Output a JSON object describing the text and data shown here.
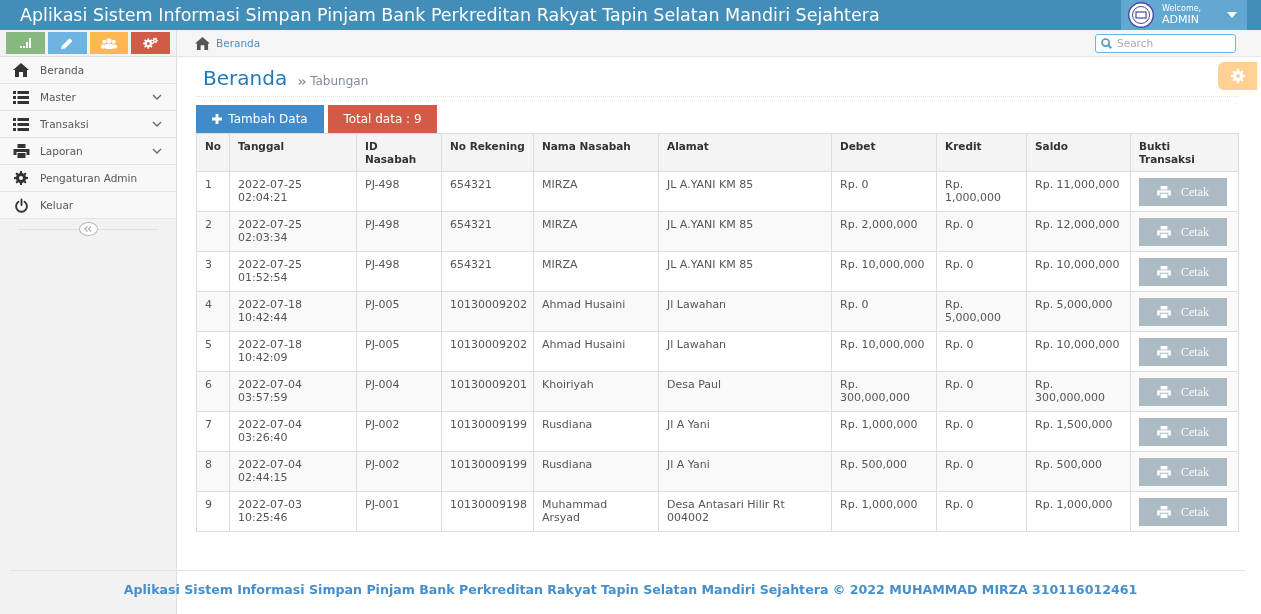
{
  "navbar": {
    "title": "Aplikasi Sistem Informasi Simpan Pinjam Bank Perkreditan Rakyat Tapin Selatan Mandiri Sejahtera",
    "user": {
      "greeting": "Welcome,",
      "name": "ADMIN"
    }
  },
  "sidebar": {
    "shortcuts": [
      {
        "kind": "chart",
        "color": "#87b87f"
      },
      {
        "kind": "pencil",
        "color": "#6fb3e0"
      },
      {
        "kind": "users",
        "color": "#ffb752"
      },
      {
        "kind": "cogs",
        "color": "#d15b47"
      }
    ],
    "menu": [
      {
        "label": "Beranda",
        "kind": "home",
        "has_submenu": false
      },
      {
        "label": "Master",
        "kind": "list",
        "has_submenu": true
      },
      {
        "label": "Transaksi",
        "kind": "list",
        "has_submenu": true
      },
      {
        "label": "Laporan",
        "kind": "print",
        "has_submenu": true
      },
      {
        "label": "Pengaturan Admin",
        "kind": "gear",
        "has_submenu": false
      },
      {
        "label": "Keluar",
        "kind": "power",
        "has_submenu": false
      }
    ]
  },
  "breadcrumb": [
    {
      "label": "Beranda"
    }
  ],
  "search": {
    "placeholder": "Search"
  },
  "page_header": {
    "title": "Beranda",
    "subtitle": "Tabungan"
  },
  "toolbar": {
    "add_button": "Tambah Data",
    "total_badge": "Total data : 9"
  },
  "table": {
    "columns": [
      "No",
      "Tanggal",
      "ID Nasabah",
      "No Rekening",
      "Nama Nasabah",
      "Alamat",
      "Debet",
      "Kredit",
      "Saldo",
      "Bukti Transaksi"
    ],
    "rows": [
      {
        "cells": [
          "1",
          "2022-07-25 02:04:21",
          "PJ-498",
          "654321",
          "MIRZA",
          "JL A.YANI KM 85",
          "Rp. 0",
          "Rp. 1,000,000",
          "Rp. 11,000,000"
        ],
        "action": "Cetak"
      },
      {
        "cells": [
          "2",
          "2022-07-25 02:03:34",
          "PJ-498",
          "654321",
          "MIRZA",
          "JL A.YANI KM 85",
          "Rp. 2,000,000",
          "Rp. 0",
          "Rp. 12,000,000"
        ],
        "action": "Cetak"
      },
      {
        "cells": [
          "3",
          "2022-07-25 01:52:54",
          "PJ-498",
          "654321",
          "MIRZA",
          "JL A.YANI KM 85",
          "Rp. 10,000,000",
          "Rp. 0",
          "Rp. 10,000,000"
        ],
        "action": "Cetak"
      },
      {
        "cells": [
          "4",
          "2022-07-18 10:42:44",
          "PJ-005",
          "10130009202",
          "Ahmad Husaini",
          "Jl Lawahan",
          "Rp. 0",
          "Rp. 5,000,000",
          "Rp. 5,000,000"
        ],
        "action": "Cetak"
      },
      {
        "cells": [
          "5",
          "2022-07-18 10:42:09",
          "PJ-005",
          "10130009202",
          "Ahmad Husaini",
          "Jl Lawahan",
          "Rp. 10,000,000",
          "Rp. 0",
          "Rp. 10,000,000"
        ],
        "action": "Cetak"
      },
      {
        "cells": [
          "6",
          "2022-07-04 03:57:59",
          "PJ-004",
          "10130009201",
          "Khoiriyah",
          "Desa Paul",
          "Rp. 300,000,000",
          "Rp. 0",
          "Rp. 300,000,000"
        ],
        "action": "Cetak"
      },
      {
        "cells": [
          "7",
          "2022-07-04 03:26:40",
          "PJ-002",
          "10130009199",
          "Rusdiana",
          "Jl A Yani",
          "Rp. 1,000,000",
          "Rp. 0",
          "Rp. 1,500,000"
        ],
        "action": "Cetak"
      },
      {
        "cells": [
          "8",
          "2022-07-04 02:44:15",
          "PJ-002",
          "10130009199",
          "Rusdiana",
          "Jl A Yani",
          "Rp. 500,000",
          "Rp. 0",
          "Rp. 500,000"
        ],
        "action": "Cetak"
      },
      {
        "cells": [
          "9",
          "2022-07-03 10:25:46",
          "PJ-001",
          "10130009198",
          "Muhammad Arsyad",
          "Desa Antasari Hilir Rt 004002",
          "Rp. 1,000,000",
          "Rp. 0",
          "Rp. 1,000,000"
        ],
        "action": "Cetak"
      }
    ]
  },
  "footer": {
    "text": "Aplikasi Sistem Informasi Simpan Pinjam Bank Perkreditan Rakyat Tapin Selatan Mandiri Sejahtera © 2022 MUHAMMAD MIRZA 310116012461"
  }
}
